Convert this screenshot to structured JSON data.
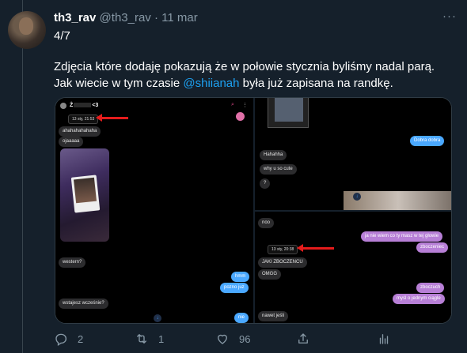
{
  "tweet": {
    "display_name": "th3_rav",
    "handle": "@th3_rav",
    "separator": "·",
    "date": "11 mar",
    "more_glyph": "···",
    "counter": "4/7",
    "text_before": "Zdjęcia które dodaję pokazują że w połowie stycznia byliśmy nadal parą. Jak wiecie w tym czasie ",
    "mention": "@shiianah",
    "text_after": " była już zapisana na randkę."
  },
  "media": {
    "left_pane": {
      "title": "Ż",
      "title_tail": "<3",
      "stamp": "13 sty, 21:53",
      "messages": [
        "ahahahahahaha",
        "ojaaaaa",
        "western?",
        "wstajesz wcześnie?"
      ],
      "outgoing": [
        "hmm",
        "pozno juz",
        "nie"
      ]
    },
    "top_right_pane": {
      "incoming": [
        "Hahahha",
        "why u so cute",
        "?"
      ],
      "outgoing": [
        "Dobra dobra"
      ]
    },
    "bottom_right_pane": {
      "stamp": "13 sty, 20:38",
      "incoming": [
        "noo",
        "JAKI ZBOCZENCU",
        "OMGG",
        "nawet jeśli"
      ],
      "outgoing": [
        "ja nie wiem co ty masz w tej głowie",
        "zboczeniec",
        "zboczuch",
        "myśl o jednym ciągle"
      ]
    },
    "icons": [
      "search-icon",
      "more-icon",
      "arrow-annotation"
    ]
  },
  "actions": {
    "reply_count": "2",
    "retweet_count": "1",
    "like_count": "96"
  },
  "colors": {
    "background": "#15202b",
    "accent": "#1da1f2",
    "muted": "#8899a6",
    "annotation_red": "#e41c1c"
  }
}
